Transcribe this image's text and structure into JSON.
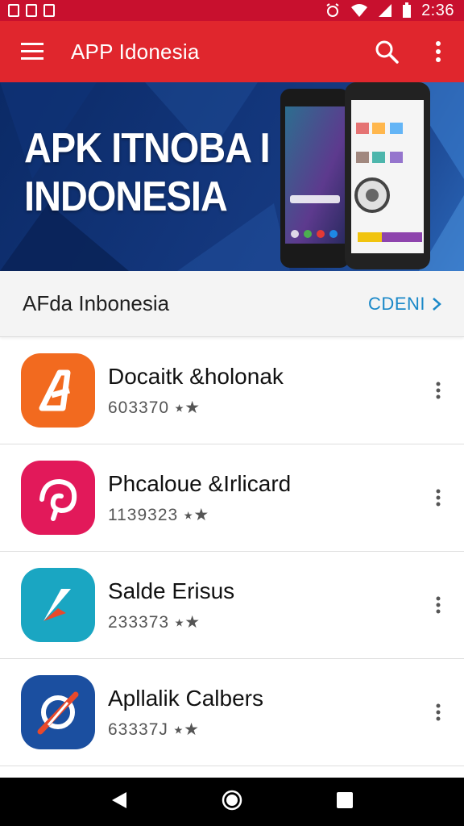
{
  "status_bar": {
    "time": "2:36"
  },
  "app_bar": {
    "title": "APP Idonesia"
  },
  "banner": {
    "line1": "APK ITNOBA I",
    "line2": "INDONESIA"
  },
  "section": {
    "title": "AFda Inbonesia",
    "link": "CDENI"
  },
  "apps": [
    {
      "name": "Docaitk &holonak",
      "meta": "603370 ⭑★",
      "icon": "letter-a-icon",
      "color": "#f26a1f"
    },
    {
      "name": "Phcaloue  &Irlicard",
      "meta": "1139323 ⭑★",
      "icon": "swirl-icon",
      "color": "#e2195a"
    },
    {
      "name": "Salde Erisus",
      "meta": "233373 ⭑★",
      "icon": "arrow-icon",
      "color": "#1aa6c2"
    },
    {
      "name": "Apllalik Calbers",
      "meta": "63337J ⭑★",
      "icon": "compass-icon",
      "color": "#1b4fa0"
    }
  ],
  "colors": {
    "status_bar": "#c8102e",
    "app_bar": "#e0262d",
    "link": "#1a88c8",
    "nav_bar": "#000000"
  }
}
